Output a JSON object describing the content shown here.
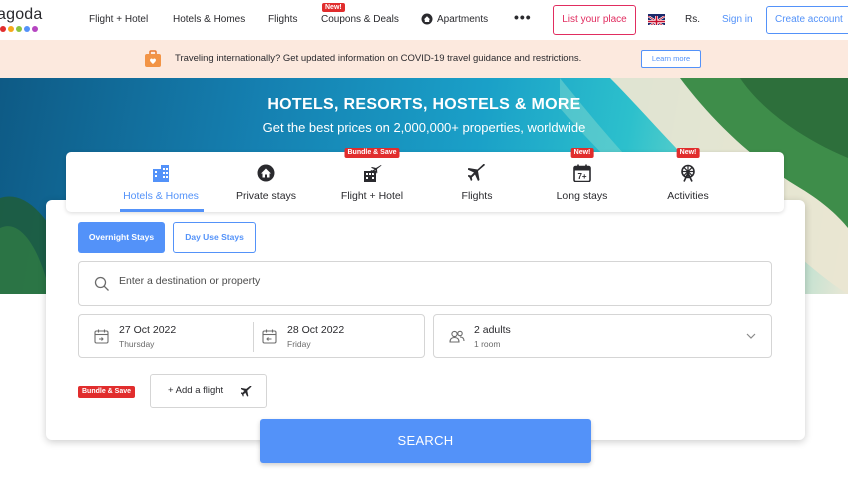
{
  "colors": {
    "accent": "#5392f9",
    "badge": "#e12d2d",
    "listPlace": "#e12d60",
    "banner": "#fce9de"
  },
  "header": {
    "logo": "agoda",
    "logo_dot_colors": [
      "#e12d2d",
      "#f7a81b",
      "#8bc53f",
      "#5392f9",
      "#b646c1"
    ],
    "nav": {
      "flight_hotel": "Flight + Hotel",
      "hotels_homes": "Hotels & Homes",
      "flights": "Flights",
      "coupons": "Coupons & Deals",
      "coupons_badge": "New!",
      "apartments": "Apartments",
      "more": "•••"
    },
    "list_place": "List your place",
    "currency": "Rs.",
    "sign_in": "Sign in",
    "create_account": "Create account"
  },
  "banner": {
    "text": "Traveling internationally? Get updated information on COVID-19 travel guidance and restrictions.",
    "button": "Learn more"
  },
  "hero": {
    "title": "HOTELS, RESORTS, HOSTELS & MORE",
    "subtitle": "Get the best prices on 2,000,000+ properties, worldwide"
  },
  "tabs": [
    {
      "label": "Hotels & Homes",
      "icon": "hotel-icon",
      "active": true,
      "badge": ""
    },
    {
      "label": "Private stays",
      "icon": "home-icon",
      "active": false,
      "badge": ""
    },
    {
      "label": "Flight + Hotel",
      "icon": "flight-hotel-icon",
      "active": false,
      "badge": "Bundle & Save"
    },
    {
      "label": "Flights",
      "icon": "plane-icon",
      "active": false,
      "badge": ""
    },
    {
      "label": "Long stays",
      "icon": "calendar-icon",
      "active": false,
      "badge": "New!"
    },
    {
      "label": "Activities",
      "icon": "ferris-wheel-icon",
      "active": false,
      "badge": "New!"
    }
  ],
  "search": {
    "overnight": "Overnight Stays",
    "dayuse": "Day Use Stays",
    "destination_placeholder": "Enter a destination or property",
    "checkin_date": "27 Oct 2022",
    "checkin_day": "Thursday",
    "checkout_date": "28 Oct 2022",
    "checkout_day": "Friday",
    "guests": "2 adults",
    "rooms": "1 room",
    "bundle_badge": "Bundle & Save",
    "add_flight": "+ Add a flight",
    "search_button": "SEARCH"
  }
}
